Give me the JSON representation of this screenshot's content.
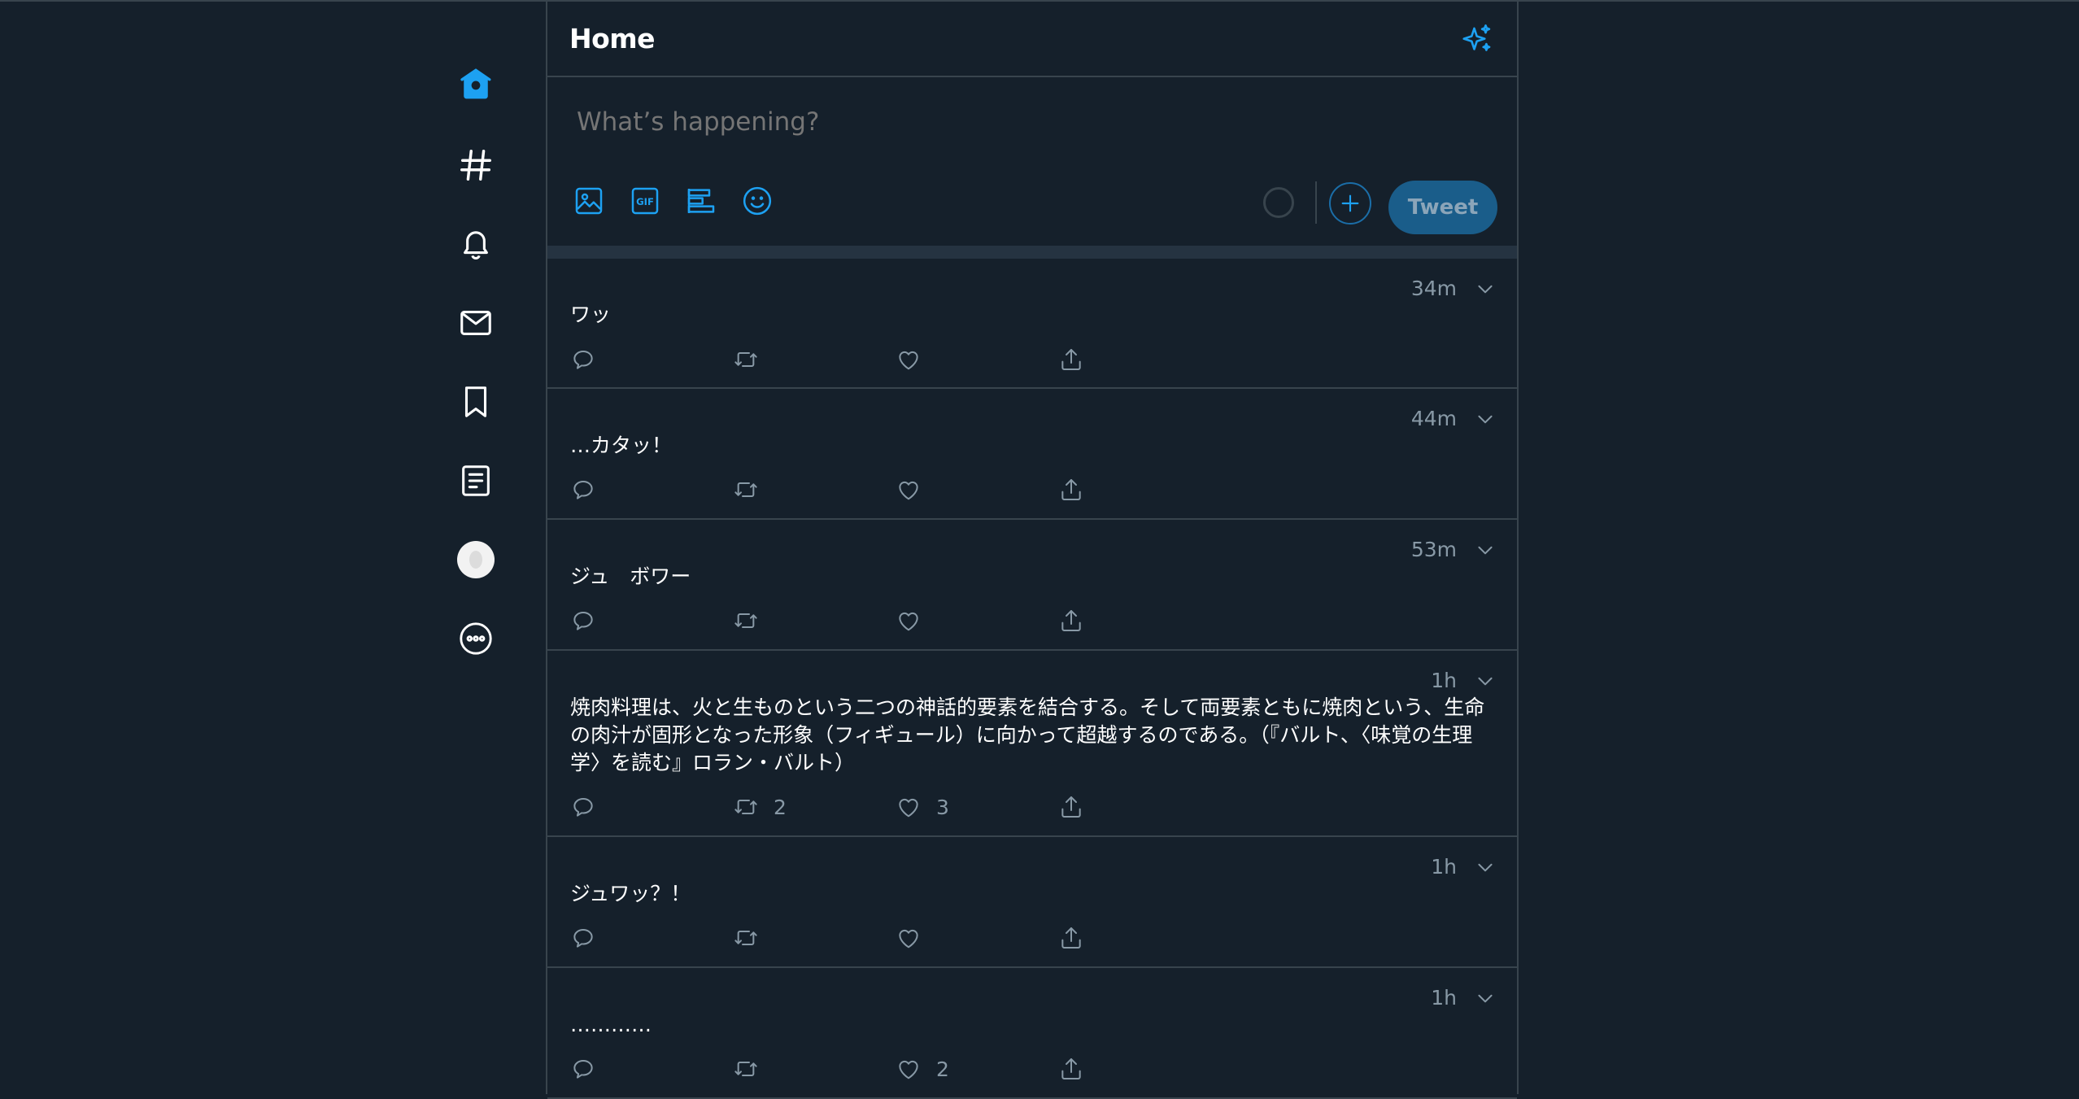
{
  "header": {
    "title": "Home"
  },
  "composer": {
    "placeholder": "What’s happening?",
    "tweet_button": "Tweet"
  },
  "nav": {
    "items": [
      {
        "icon": "home-icon"
      },
      {
        "icon": "explore-hashtag-icon"
      },
      {
        "icon": "notifications-bell-icon"
      },
      {
        "icon": "messages-envelope-icon"
      },
      {
        "icon": "bookmark-icon"
      },
      {
        "icon": "lists-icon"
      },
      {
        "icon": "profile-avatar"
      },
      {
        "icon": "more-icon"
      }
    ]
  },
  "colors": {
    "accent": "#1da1f2",
    "background": "#15202b",
    "muted": "#8899a6",
    "border": "#38444d"
  },
  "tweets": [
    {
      "time": "34m",
      "text": "ワッ",
      "retweets": "",
      "likes": ""
    },
    {
      "time": "44m",
      "text": "…カタッ！",
      "retweets": "",
      "likes": ""
    },
    {
      "time": "53m",
      "text": "ジュ　ボワー",
      "retweets": "",
      "likes": ""
    },
    {
      "time": "1h",
      "text": "焼肉料理は、火と生ものという二つの神話的要素を結合する。そして両要素ともに焼肉という、生命の肉汁が固形となった形象（フィギュール）に向かって超越するのである。（『バルト、〈味覚の生理学〉を読む』ロラン・バルト）",
      "retweets": "2",
      "likes": "3"
    },
    {
      "time": "1h",
      "text": "ジュワッ？！",
      "retweets": "",
      "likes": ""
    },
    {
      "time": "1h",
      "text": "…………",
      "retweets": "",
      "likes": "2"
    }
  ]
}
